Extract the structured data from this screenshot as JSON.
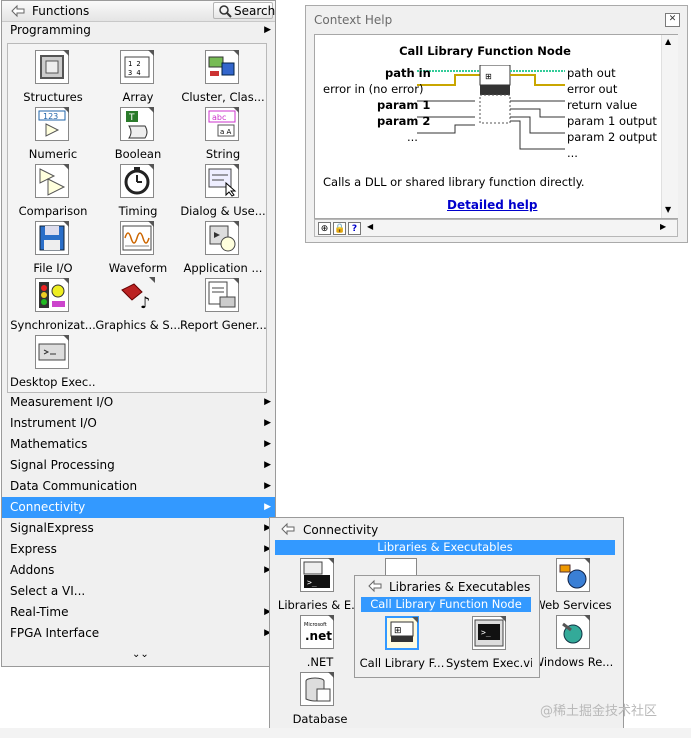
{
  "palette": {
    "title": "Functions",
    "search_label": "Search",
    "top_category": "Programming",
    "tiles": [
      {
        "label": "Structures",
        "icon": "structures-icon"
      },
      {
        "label": "Array",
        "icon": "array-icon"
      },
      {
        "label": "Cluster, Clas...",
        "icon": "cluster-icon"
      },
      {
        "label": "Numeric",
        "icon": "numeric-icon"
      },
      {
        "label": "Boolean",
        "icon": "boolean-icon"
      },
      {
        "label": "String",
        "icon": "string-icon"
      },
      {
        "label": "Comparison",
        "icon": "comparison-icon"
      },
      {
        "label": "Timing",
        "icon": "timing-icon"
      },
      {
        "label": "Dialog & Use...",
        "icon": "dialog-icon"
      },
      {
        "label": "File I/O",
        "icon": "file-io-icon"
      },
      {
        "label": "Waveform",
        "icon": "waveform-icon"
      },
      {
        "label": "Application ...",
        "icon": "application-control-icon"
      },
      {
        "label": "Synchronizat...",
        "icon": "synchronization-icon"
      },
      {
        "label": "Graphics & S...",
        "icon": "graphics-sound-icon"
      },
      {
        "label": "Report Gener...",
        "icon": "report-generation-icon"
      },
      {
        "label": "Desktop Exec...",
        "icon": "desktop-execution-icon"
      }
    ],
    "categories": [
      "Measurement I/O",
      "Instrument I/O",
      "Mathematics",
      "Signal Processing",
      "Data Communication",
      "Connectivity",
      "SignalExpress",
      "Express",
      "Addons",
      "Select a VI...",
      "Real-Time",
      "FPGA Interface"
    ],
    "selected_category": "Connectivity"
  },
  "context_help": {
    "title": "Context Help",
    "heading": "Call Library Function Node",
    "inputs": [
      "path in",
      "error in (no error)",
      "param 1",
      "param 2",
      "..."
    ],
    "outputs": [
      "path out",
      "error out",
      "return value",
      "param 1 output",
      "param 2 output",
      "..."
    ],
    "description": "Calls a DLL or shared library function directly.",
    "link": "Detailed help"
  },
  "connectivity": {
    "title": "Connectivity",
    "highlight": "Libraries & Executables",
    "tiles": [
      {
        "label": "Libraries & E...",
        "icon": "libraries-executables-icon"
      },
      {
        "label": "Web Services",
        "icon": "web-services-icon"
      },
      {
        "label": ".NET",
        "icon": "dotnet-icon"
      },
      {
        "label": "Windows Re...",
        "icon": "windows-registry-icon"
      },
      {
        "label": "Database",
        "icon": "database-icon"
      }
    ],
    "dotnet_icon_text": ".net",
    "dotnet_brand": "Microsoft"
  },
  "libraries": {
    "title": "Libraries & Executables",
    "highlight": "Call Library Function Node",
    "tiles": [
      {
        "label": "Call Library F...",
        "icon": "call-library-icon"
      },
      {
        "label": "System Exec.vi",
        "icon": "system-exec-icon"
      }
    ]
  },
  "watermark": "@稀土掘金技术社区",
  "colors": {
    "selection": "#3399ff",
    "link": "#0000cc"
  }
}
